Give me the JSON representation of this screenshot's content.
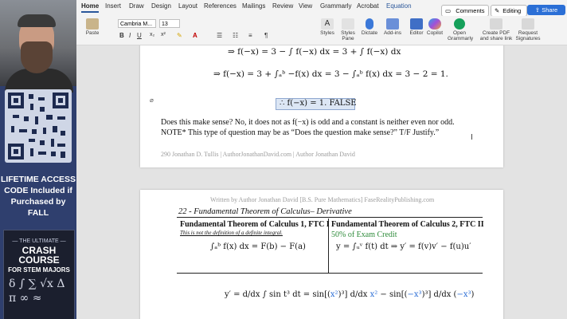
{
  "promo": {
    "access_line1": "LIFETIME ACCESS",
    "access_line2": "CODE Included if",
    "access_line3": "Purchased by FALL",
    "book_line1": "— THE ULTIMATE —",
    "book_line2": "CRASH COURSE",
    "book_line3": "FOR STEM MAJORS",
    "book_symbols": "δ ∫ ∑ √x Δ π ∞ ≈"
  },
  "tabs": [
    "Home",
    "Insert",
    "Draw",
    "Design",
    "Layout",
    "References",
    "Mailings",
    "Review",
    "View",
    "Grammarly",
    "Acrobat",
    "Equation"
  ],
  "topbar": {
    "comments": "Comments",
    "editing": "Editing",
    "share": "Share"
  },
  "ribbon": {
    "paste": "Paste",
    "font_name": "Cambria M...",
    "font_size": "13",
    "styles": "Styles",
    "styles_pane": "Styles Pane",
    "dictate": "Dictate",
    "addins": "Add-ins",
    "editor": "Editor",
    "copilot": "Copilot",
    "open_grammarly": "Open Grammarly",
    "create_pdf": "Create PDF and share link",
    "request_signatures": "Request Signatures"
  },
  "page1": {
    "eq1": "⇒  f(−x) = 3 − ∫ f(−x) dx = 3 + ∫ f(−x) dx",
    "eq2": "⇒  f(−x) = 3 + ∫ₐᵇ −f(x) dx = 3 − ∫ₐᵇ f(x) dx = 3 − 2 = 1.",
    "conclusion": "∴  f(−x) = 1. FALSE",
    "para1": "Does this make sense? No, it does not as f(−x) is odd and a constant is neither even nor odd.",
    "para2": "NOTE* This type of question may be as “Does the question make sense?” T/F Justify.”",
    "footer": "290                  Jonathan D. Tullis | AuthorJonathanDavid.com | Author Jonathan David"
  },
  "page2": {
    "header": "Written by Author Jonathan David [B.S. Pure Mathematics] FaseRealityPublishing.com",
    "section_title": "22 - Fundamental Theorem of Calculus– Derivative",
    "ftc1_title": "Fundamental Theorem of Calculus 1, FTC I",
    "ftc1_note": "This is not the definition of a definite integral.",
    "ftc1_eq": "∫ₐᵇ f(x) dx = F(b) − F(a)",
    "ftc2_title": "Fundamental Theorem of Calculus 2, FTC II",
    "ftc2_credit": "50% of Exam Credit",
    "ftc2_eq": "y = ∫ᵤᵛ f(t) dt  ⇒  y′ = f(v)v′ − f(u)u′",
    "example_lhs": "y′ = d/dx ∫ sin t³ dt = sin[(",
    "example_x2": "x²",
    "example_mid": ")³] d/dx ",
    "example_x2b": "x²",
    "example_mid2": " − sin[(",
    "example_x3": "−x³",
    "example_mid3": ")³] d/dx (",
    "example_x3b": "−x³",
    "example_end": ")"
  }
}
